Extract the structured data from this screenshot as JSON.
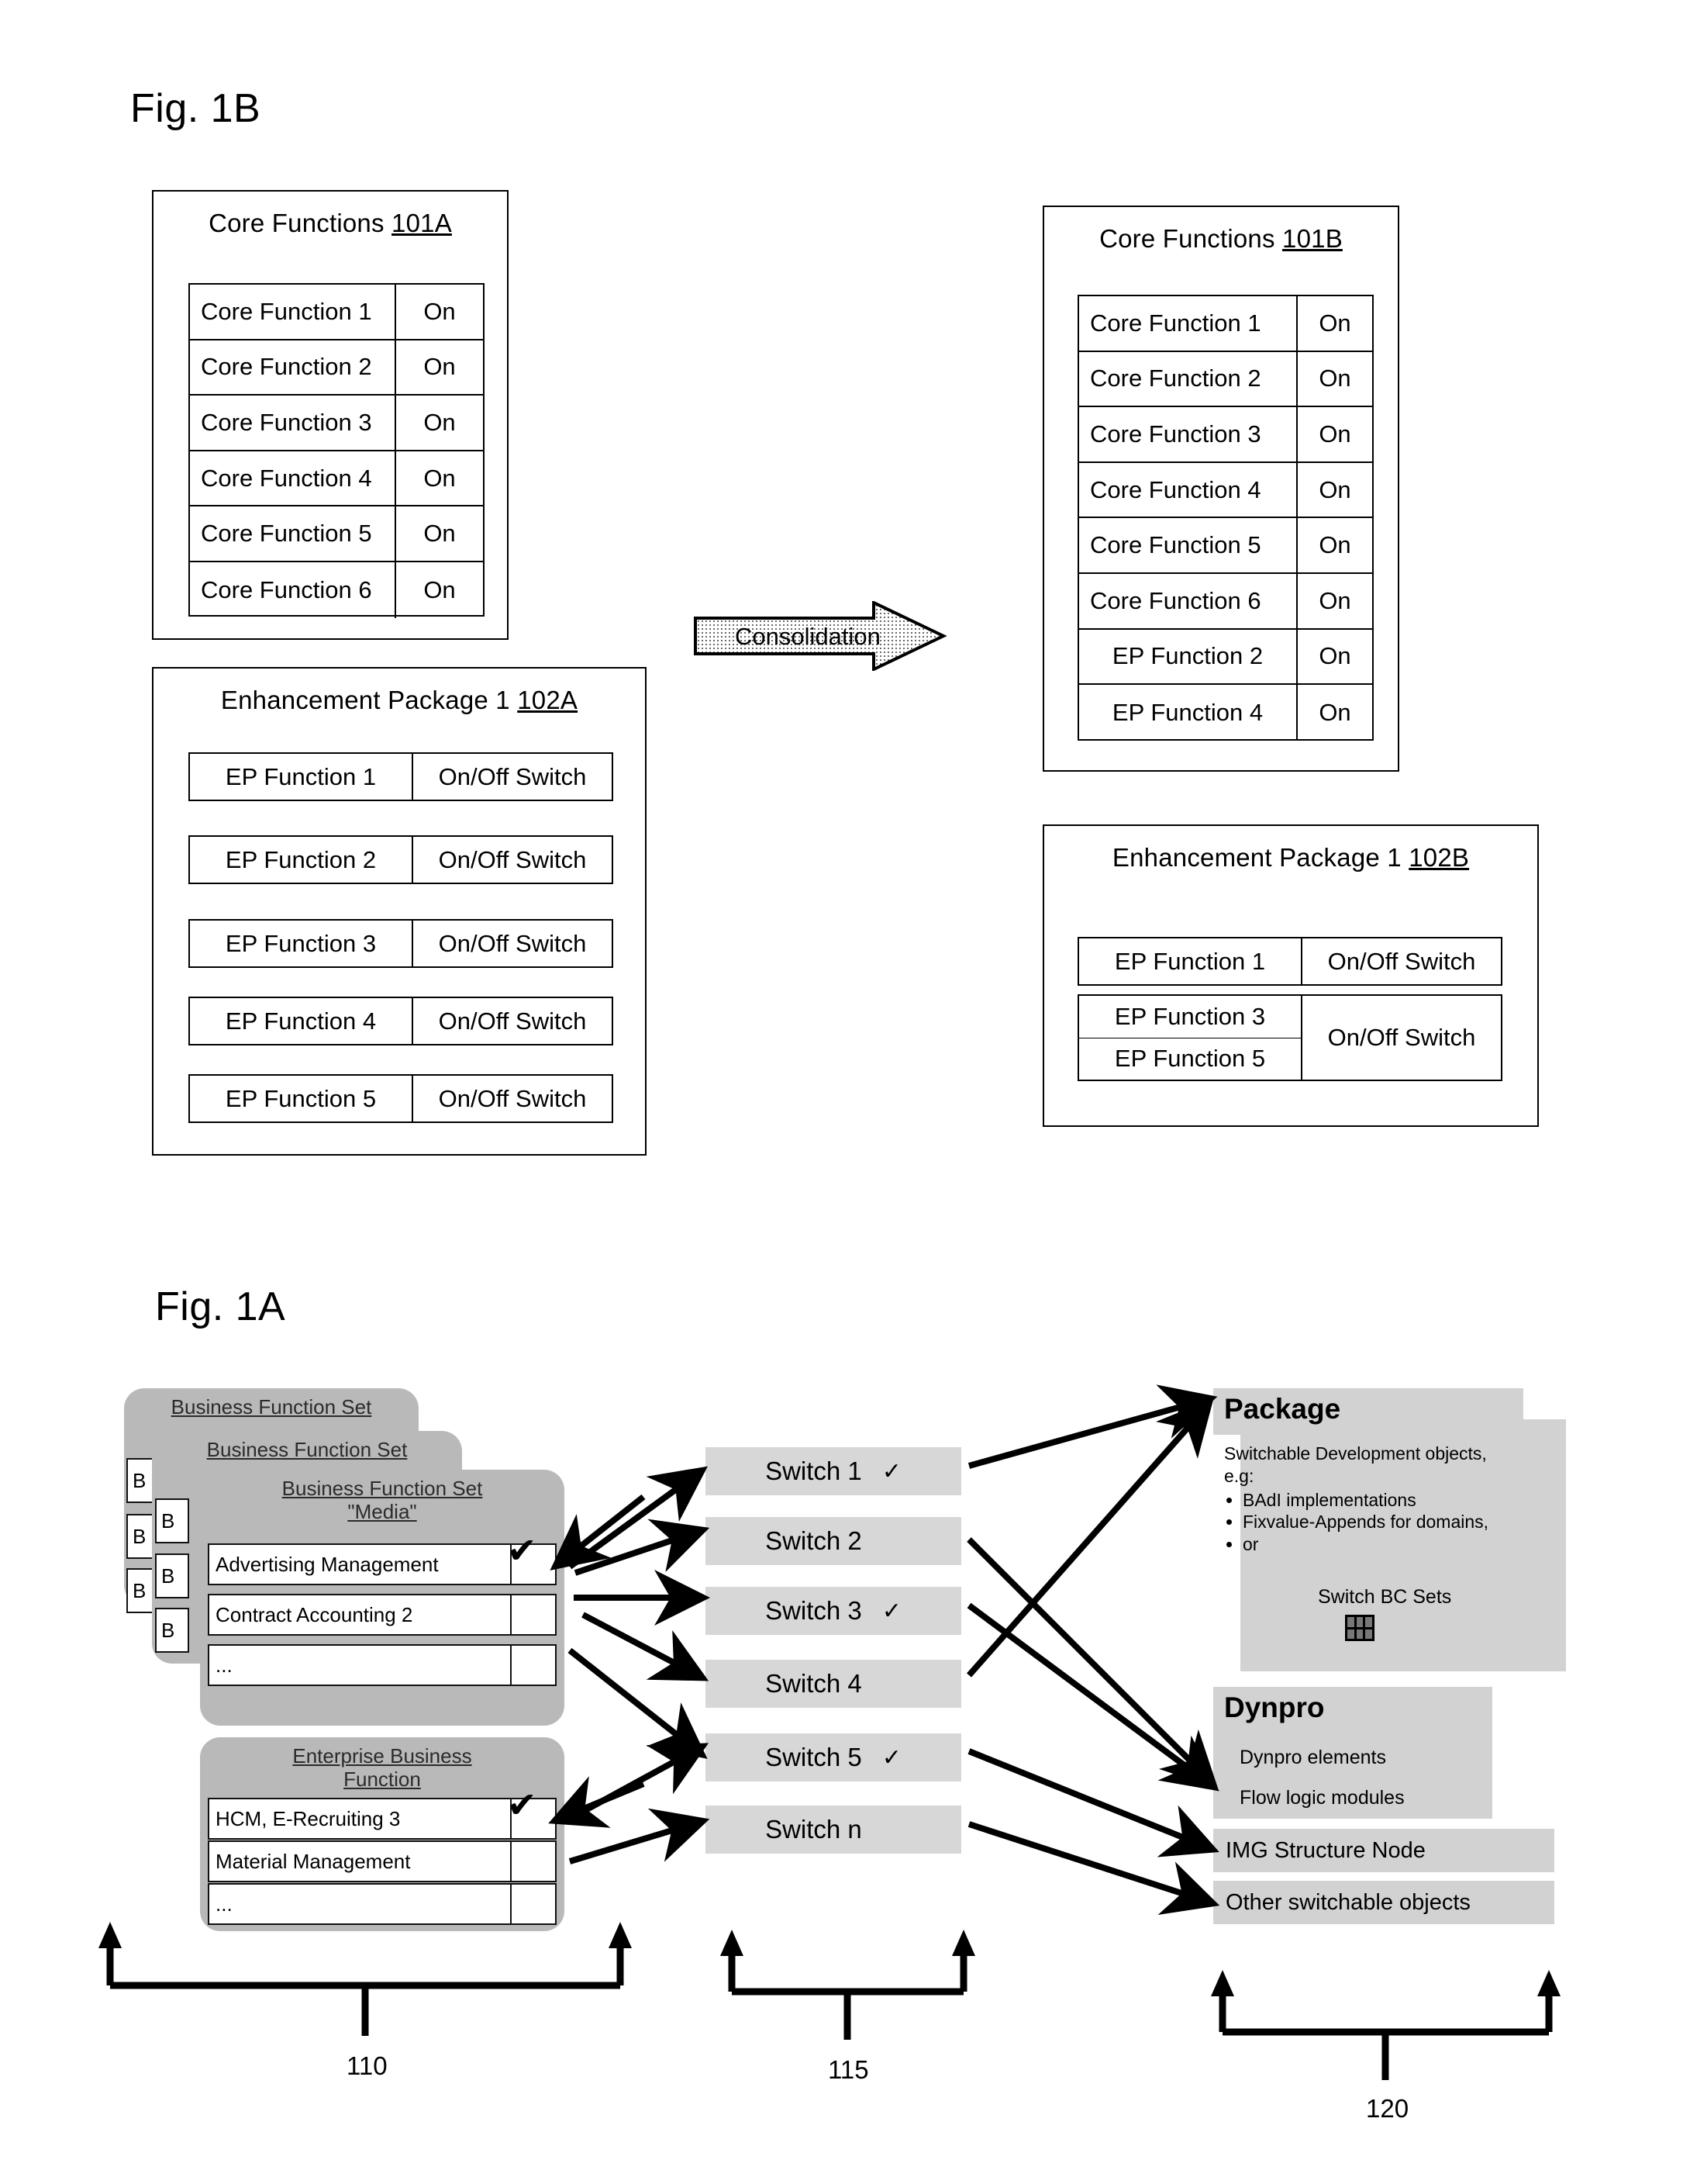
{
  "figures": {
    "fig1b_label": "Fig. 1B",
    "fig1a_label": "Fig. 1A"
  },
  "fig1b": {
    "core_before": {
      "title_text": "Core Functions ",
      "title_ref": "101A",
      "rows": [
        {
          "name": "Core Function 1",
          "state": "On"
        },
        {
          "name": "Core Function 2",
          "state": "On"
        },
        {
          "name": "Core Function 3",
          "state": "On"
        },
        {
          "name": "Core Function 4",
          "state": "On"
        },
        {
          "name": "Core Function 5",
          "state": "On"
        },
        {
          "name": "Core Function 6",
          "state": "On"
        }
      ]
    },
    "ep_before": {
      "title_text": "Enhancement Package 1 ",
      "title_ref": "102A",
      "rows": [
        {
          "name": "EP Function 1",
          "state": "On/Off Switch"
        },
        {
          "name": "EP Function 2",
          "state": "On/Off Switch"
        },
        {
          "name": "EP Function 3",
          "state": "On/Off Switch"
        },
        {
          "name": "EP Function 4",
          "state": "On/Off Switch"
        },
        {
          "name": "EP Function 5",
          "state": "On/Off Switch"
        }
      ]
    },
    "arrow_label": "Consolidation",
    "core_after": {
      "title_text": "Core Functions ",
      "title_ref": "101B",
      "rows": [
        {
          "name": "Core Function 1",
          "state": "On"
        },
        {
          "name": "Core Function 2",
          "state": "On"
        },
        {
          "name": "Core Function 3",
          "state": "On"
        },
        {
          "name": "Core Function 4",
          "state": "On"
        },
        {
          "name": "Core Function 5",
          "state": "On"
        },
        {
          "name": "Core Function 6",
          "state": "On"
        },
        {
          "name": "EP Function 2",
          "state": "On"
        },
        {
          "name": "EP Function 4",
          "state": "On"
        }
      ]
    },
    "ep_after": {
      "title_text": "Enhancement Package 1 ",
      "title_ref": "102B",
      "single": {
        "name": "EP Function 1",
        "state": "On/Off Switch"
      },
      "grouped": {
        "name_top": "EP Function 3",
        "name_bottom": "EP Function 5",
        "state": "On/Off Switch"
      }
    }
  },
  "fig1a": {
    "business_function_set_stack": {
      "back_title": "Business Function Set",
      "mid_title": "Business Function Set",
      "front_title_line1": "Business Function Set",
      "front_title_line2": "\"Media\"",
      "items": [
        {
          "label": "Advertising Management",
          "checked": true
        },
        {
          "label": "Contract Accounting 2",
          "checked": false
        },
        {
          "label": "...",
          "checked": false
        }
      ],
      "stub_label": "B"
    },
    "enterprise_business_function": {
      "title_line1": "Enterprise Business",
      "title_line2": "Function",
      "items": [
        {
          "label": "HCM, E-Recruiting 3",
          "checked": true
        },
        {
          "label": "Material Management",
          "checked": false
        },
        {
          "label": "...",
          "checked": false
        }
      ]
    },
    "switches": [
      {
        "label": "Switch 1",
        "checked": true
      },
      {
        "label": "Switch 2",
        "checked": false
      },
      {
        "label": "Switch 3",
        "checked": true
      },
      {
        "label": "Switch 4",
        "checked": false
      },
      {
        "label": "Switch 5",
        "checked": true
      },
      {
        "label": "Switch n",
        "checked": false
      }
    ],
    "package": {
      "title": "Package",
      "intro_line1": "Switchable Development objects,",
      "intro_line2": "e.g:",
      "bullets": [
        "BAdI implementations",
        "Fixvalue-Appends for domains,",
        "or"
      ],
      "bc_sets_label": "Switch BC Sets"
    },
    "dynpro": {
      "title": "Dynpro",
      "sub": [
        "Dynpro elements",
        "Flow logic modules"
      ]
    },
    "img_structure_node": "IMG Structure Node",
    "other_objects": "Other switchable objects",
    "brackets": [
      {
        "num": "110"
      },
      {
        "num": "115"
      },
      {
        "num": "120"
      }
    ]
  }
}
